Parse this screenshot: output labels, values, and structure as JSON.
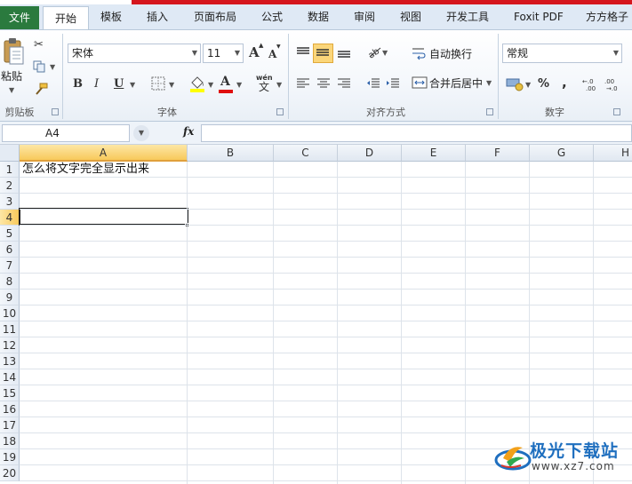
{
  "tabs": {
    "file": "文件",
    "items": [
      "开始",
      "模板",
      "插入",
      "页面布局",
      "公式",
      "数据",
      "审阅",
      "视图",
      "开发工具",
      "Foxit PDF",
      "方方格子"
    ],
    "active_index": 0
  },
  "ribbon": {
    "clipboard": {
      "paste_label": "粘贴",
      "group_label": "剪贴板"
    },
    "font": {
      "font_name": "宋体",
      "font_size": "11",
      "bold": "B",
      "italic": "I",
      "underline": "U",
      "grow": "A",
      "shrink": "A",
      "font_color_glyph": "A",
      "phonetic_top": "wén",
      "phonetic_bottom": "文",
      "group_label": "字体"
    },
    "alignment": {
      "wrap_text": "自动换行",
      "merge_center": "合并后居中",
      "group_label": "对齐方式"
    },
    "number": {
      "format": "常规",
      "percent": "%",
      "comma": ",",
      "group_label": "数字"
    }
  },
  "formula_bar": {
    "name_box": "A4",
    "fx": "fx",
    "content": ""
  },
  "sheet": {
    "columns": [
      "A",
      "B",
      "C",
      "D",
      "E",
      "F",
      "G",
      "H"
    ],
    "selected_column": "A",
    "rows": [
      "1",
      "2",
      "3",
      "4",
      "5",
      "6",
      "7",
      "8",
      "9",
      "10",
      "11",
      "12",
      "13",
      "14",
      "15",
      "16",
      "17",
      "18",
      "19",
      "20"
    ],
    "selected_row": "4",
    "cells": {
      "A1": "怎么将文字完全显示出来"
    }
  },
  "watermark": {
    "title": "极光下载站",
    "url": "www.xz7.com"
  },
  "colors": {
    "file_tab": "#2a7a3e",
    "accent_red": "#d5161d",
    "selection_header": "#f8c95b",
    "highlight_button": "#fbd67a"
  }
}
